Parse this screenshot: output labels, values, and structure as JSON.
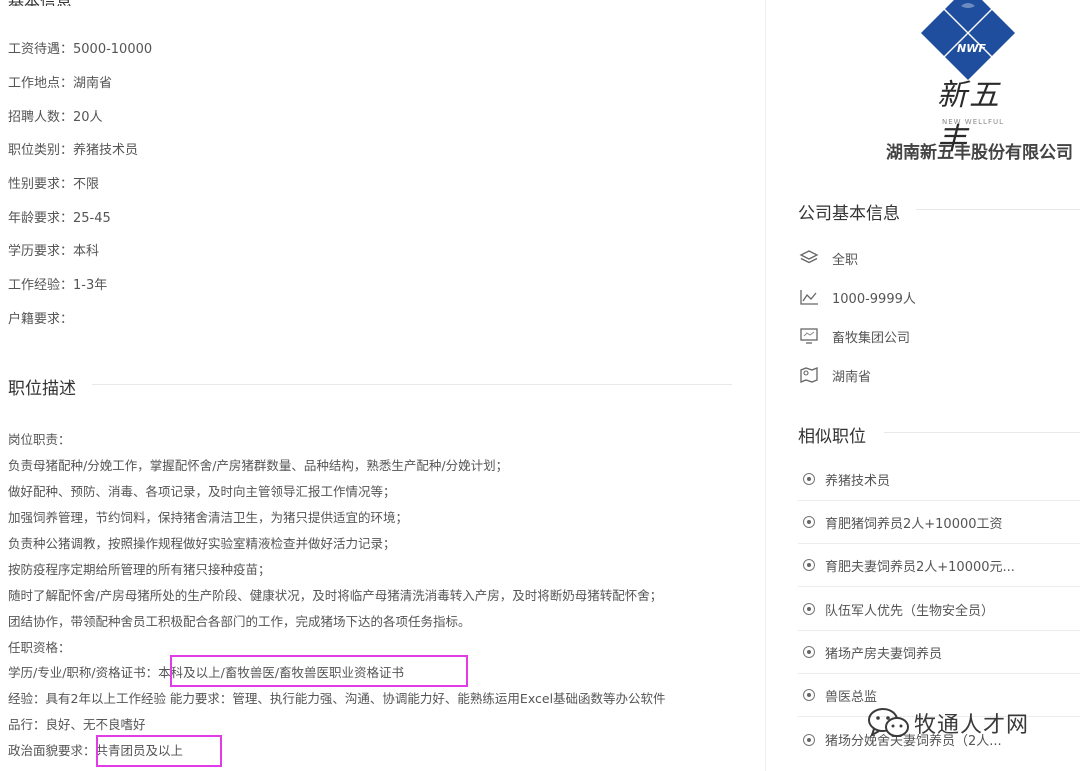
{
  "job_basic": {
    "rows": [
      "工资待遇：5000-10000",
      "工作地点：湖南省",
      "招聘人数：20人",
      "职位类别：养猪技术员",
      "性别要求：不限",
      "年龄要求：25-45",
      "学历要求：本科",
      "工作经验：1-3年",
      "户籍要求："
    ]
  },
  "description": {
    "title": "职位描述",
    "lines": [
      "岗位职责：",
      "负责母猪配种/分娩工作，掌握配怀舍/产房猪群数量、品种结构，熟悉生产配种/分娩计划；",
      "做好配种、预防、消毒、各项记录，及时向主管领导汇报工作情况等；",
      "加强饲养管理，节约饲料，保持猪舍清洁卫生，为猪只提供适宜的环境；",
      "负责种公猪调教，按照操作规程做好实验室精液检查并做好活力记录；",
      "按防疫程序定期给所管理的所有猪只接种疫苗；",
      "随时了解配怀舍/产房母猪所处的生产阶段、健康状况，及时将临产母猪清洗消毒转入产房，及时将断奶母猪转配怀舍；",
      "团结协作，带领配种舍员工积极配合各部门的工作，完成猪场下达的各项任务指标。",
      "任职资格：",
      "学历/专业/职称/资格证书：本科及以上/畜牧兽医/畜牧兽医职业资格证书",
      "经验：具有2年以上工作经验 能力要求：管理、执行能力强、沟通、协调能力好、能熟练运用Excel基础函数等办公软件",
      "品行：良好、无不良嗜好",
      "政治面貌要求：共青团员及以上"
    ]
  },
  "company": {
    "logo_text": "新五丰",
    "logo_badge": "NWF",
    "logo_en": "NEW WELLFUL",
    "name": "湖南新五丰股份有限公司",
    "basic_title": "公司基本信息",
    "basic_items": [
      {
        "icon": "layers-icon",
        "text": "全职"
      },
      {
        "icon": "chart-icon",
        "text": "1000-9999人"
      },
      {
        "icon": "monitor-icon",
        "text": "畜牧集团公司"
      },
      {
        "icon": "map-icon",
        "text": "湖南省"
      }
    ]
  },
  "similar": {
    "title": "相似职位",
    "items": [
      "养猪技术员",
      "育肥猪饲养员2人+10000工资",
      "育肥夫妻饲养员2人+10000元...",
      "队伍军人优先（生物安全员）",
      "猪场产房夫妻饲养员",
      "兽医总监",
      "猪场分娩舍夫妻饲养员（2人..."
    ]
  },
  "watermark": {
    "text": "牧通人才网"
  },
  "colors": {
    "logo_blue": "#1f4e9e",
    "highlight": "#e23be8"
  }
}
